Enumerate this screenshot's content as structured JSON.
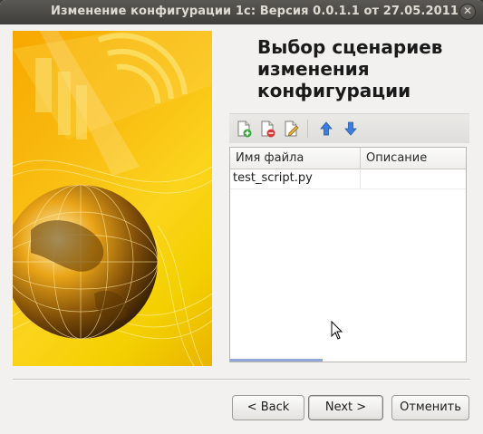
{
  "window": {
    "title": "Изменение конфигурации 1с: Версия 0.0.1.1 от 27.05.2011",
    "close_symbol": "✕"
  },
  "page": {
    "title_line1": "Выбор сценариев",
    "title_line2": "изменения",
    "title_line3": "конфигурации"
  },
  "toolbar": {
    "buttons": [
      {
        "icon": "add-document-icon"
      },
      {
        "icon": "remove-document-icon"
      },
      {
        "icon": "edit-document-icon"
      },
      {
        "icon": "arrow-up-icon"
      },
      {
        "icon": "arrow-down-icon"
      }
    ]
  },
  "table": {
    "columns": [
      "Имя файла",
      "Описание"
    ],
    "rows": [
      {
        "file": "test_script.py",
        "description": ""
      }
    ]
  },
  "buttons": {
    "back": "< Back",
    "next": "Next >",
    "cancel": "Отменить"
  },
  "colors": {
    "titlebar": "#3f3e3a",
    "accent_blue": "#3d7ddb",
    "image_orange": "#f7a800"
  }
}
